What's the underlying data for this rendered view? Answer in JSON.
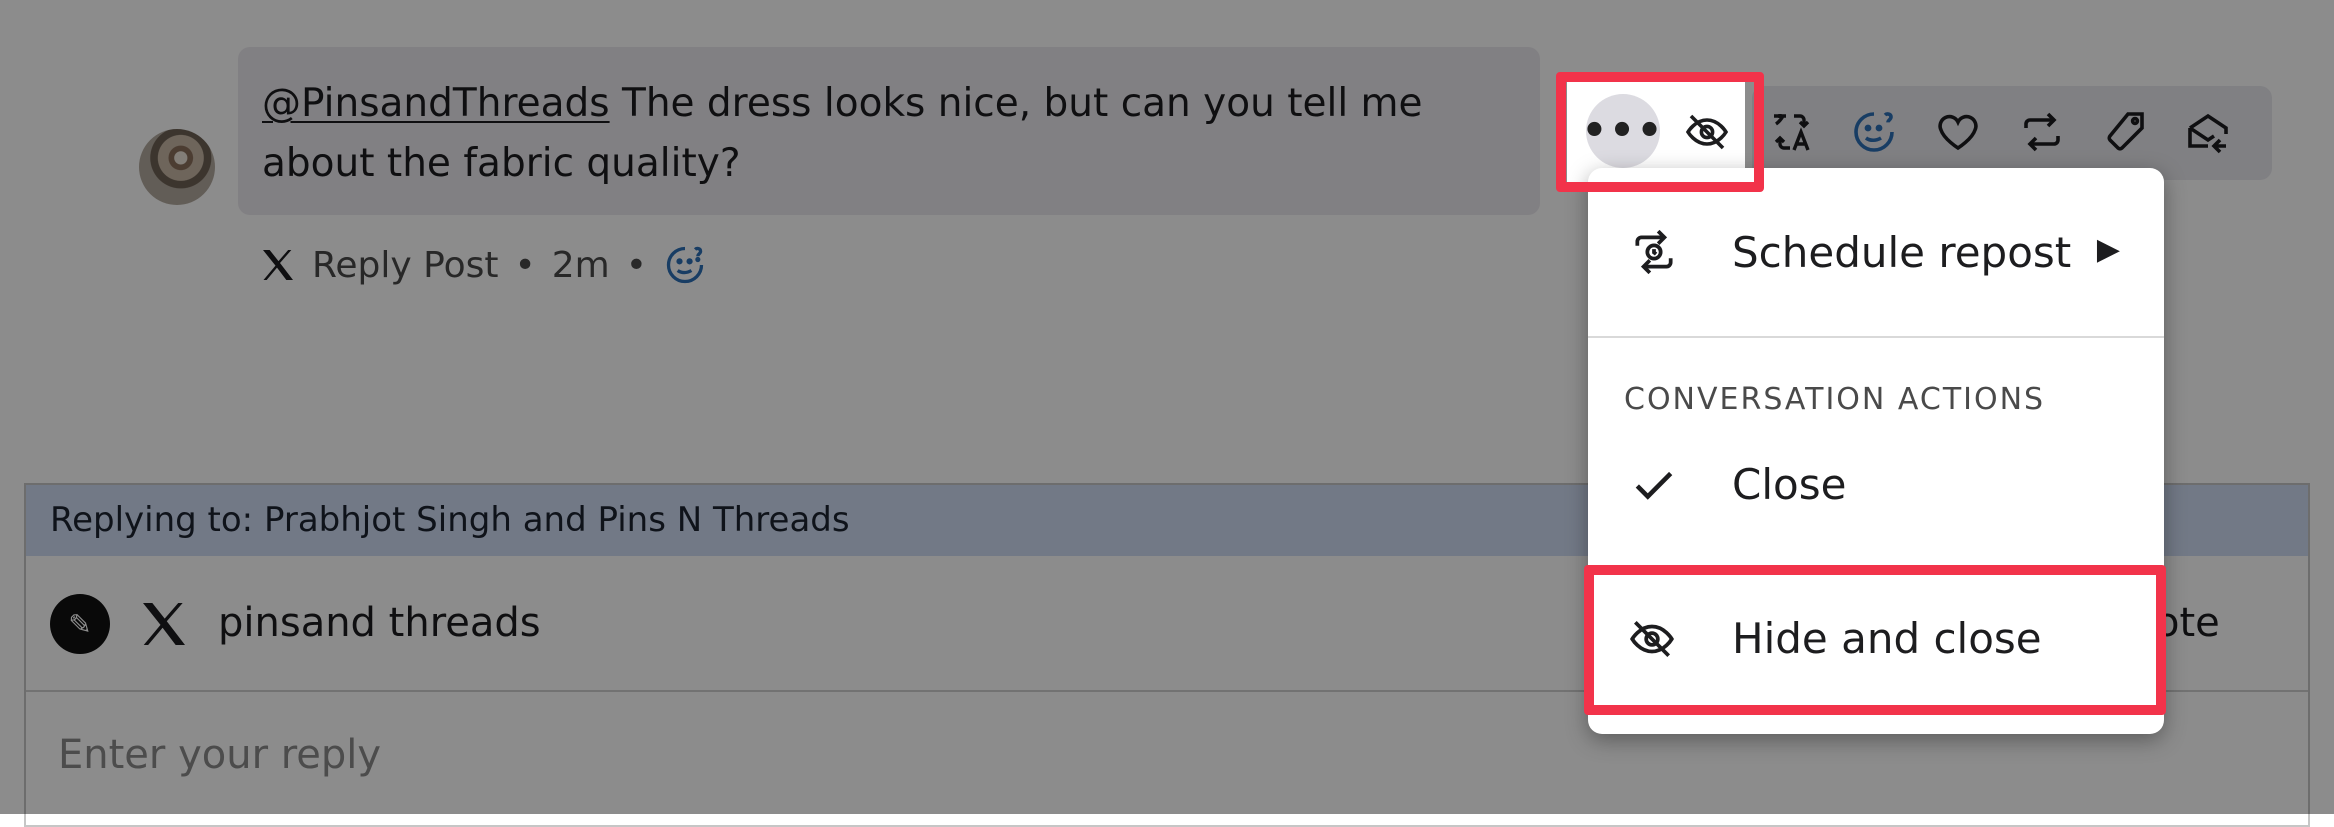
{
  "comment": {
    "mention": "@PinsandThreads",
    "text": " The dress looks nice, but can you tell me about the fabric quality?",
    "meta": {
      "type_label": "Reply Post",
      "time": "2m"
    }
  },
  "toolbar": {
    "more_label": "•••",
    "icons": [
      "more-icon",
      "hide-icon",
      "translate-icon",
      "sentiment-icon",
      "like-icon",
      "retweet-icon",
      "tag-icon",
      "mark-read-icon"
    ]
  },
  "menu": {
    "schedule_repost": "Schedule repost",
    "section_title": "CONVERSATION ACTIONS",
    "close": "Close",
    "hide_and_close": "Hide and close"
  },
  "reply": {
    "replying_to": "Replying to: Prabhjot Singh and Pins N Threads",
    "account_name": "pinsand threads",
    "right_label": "ote",
    "placeholder": "Enter your reply"
  },
  "colors": {
    "highlight": "#f2334a",
    "reply_header": "#cfdcf4",
    "sentiment_blue": "#2c6fb6"
  }
}
